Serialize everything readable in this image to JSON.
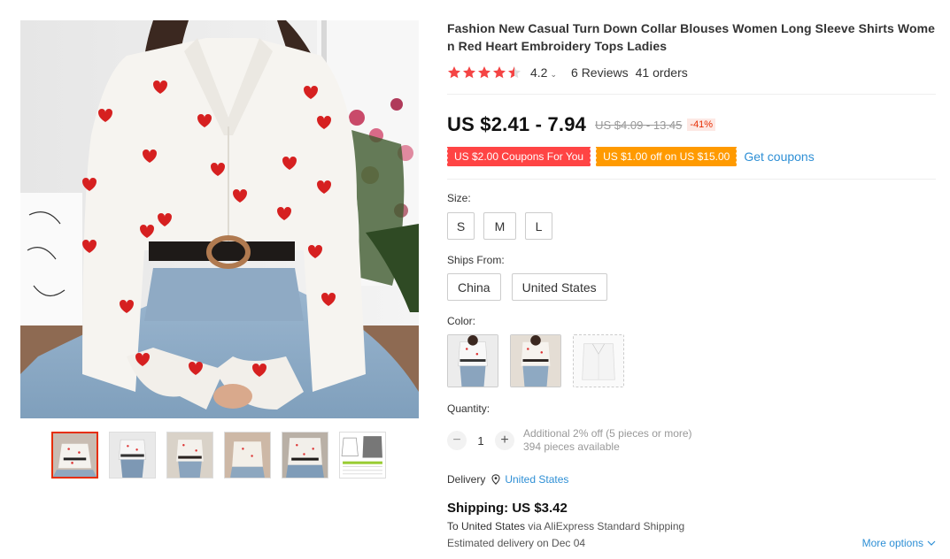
{
  "product": {
    "title": "Fashion New Casual Turn Down Collar Blouses Women Long Sleeve Shirts Women Red Heart Embroidery Tops Ladies",
    "rating": "4.2",
    "reviews": "6 Reviews",
    "orders": "41 orders",
    "star_fill": [
      1,
      1,
      1,
      1,
      0.5
    ]
  },
  "price": {
    "current": "US $2.41 - 7.94",
    "original": "US $4.09 - 13.45",
    "discount": "-41%"
  },
  "coupons": {
    "coupon1": "US $2.00 Coupons For You",
    "coupon2": "US $1.00 off on US $15.00",
    "get_label": "Get coupons"
  },
  "size": {
    "label": "Size:",
    "options": [
      "S",
      "M",
      "L"
    ]
  },
  "ships_from": {
    "label": "Ships From:",
    "options": [
      "China",
      "United States"
    ]
  },
  "color": {
    "label": "Color:"
  },
  "quantity": {
    "label": "Quantity:",
    "minus": "−",
    "value": "1",
    "plus": "+",
    "additional": "Additional 2% off (5 pieces or more)",
    "available": "394 pieces available"
  },
  "delivery": {
    "label": "Delivery",
    "location": "United States"
  },
  "shipping": {
    "title": "Shipping: US $3.42",
    "to_prefix": "To United States",
    "via_text": "via AliExpress Standard Shipping",
    "estimated": "Estimated delivery on Dec 04",
    "more_options": "More options"
  },
  "colors": {
    "star": "#f44444",
    "accent_red": "#e62e04",
    "link_blue": "#2e8fd5",
    "coupon_red": "#ff4444",
    "coupon_orange": "#ff9a00"
  }
}
